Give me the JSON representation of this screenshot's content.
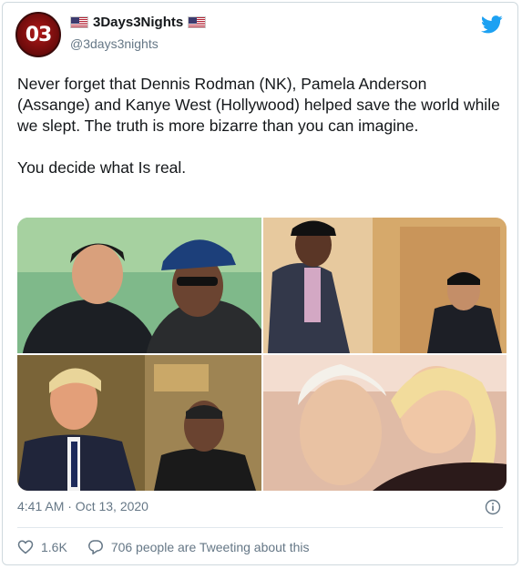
{
  "author": {
    "avatar_text": "03",
    "display_name": "3Days3Nights",
    "handle": "@3days3nights"
  },
  "tweet": {
    "paragraph_1": "Never forget that Dennis Rodman (NK), Pamela Anderson (Assange) and Kanye West (Hollywood) helped save the world while we slept. The truth is more bizarre than you can imagine.",
    "paragraph_2": "You decide what Is real."
  },
  "photos": [
    {
      "subject": "two men talking, one in dark suit, one in cap and sunglasses"
    },
    {
      "subject": "tall man in pinstripe suit and cap beside man in dark suit"
    },
    {
      "subject": "two men standing in a lobby, one in suit and tie"
    },
    {
      "subject": "close-up of man with white hair and woman with blonde hair"
    }
  ],
  "timestamp": "4:41 AM · Oct 13, 2020",
  "actions": {
    "likes": "1.6K",
    "replies_label": "706 people are Tweeting about this"
  },
  "colors": {
    "twitter_blue": "#1da1f2",
    "secondary_text": "#657786",
    "primary_text": "#14171a",
    "border": "#cfd9de"
  },
  "icons": [
    "twitter-bird-icon",
    "info-icon",
    "heart-icon",
    "comment-icon",
    "us-flag-icon"
  ]
}
